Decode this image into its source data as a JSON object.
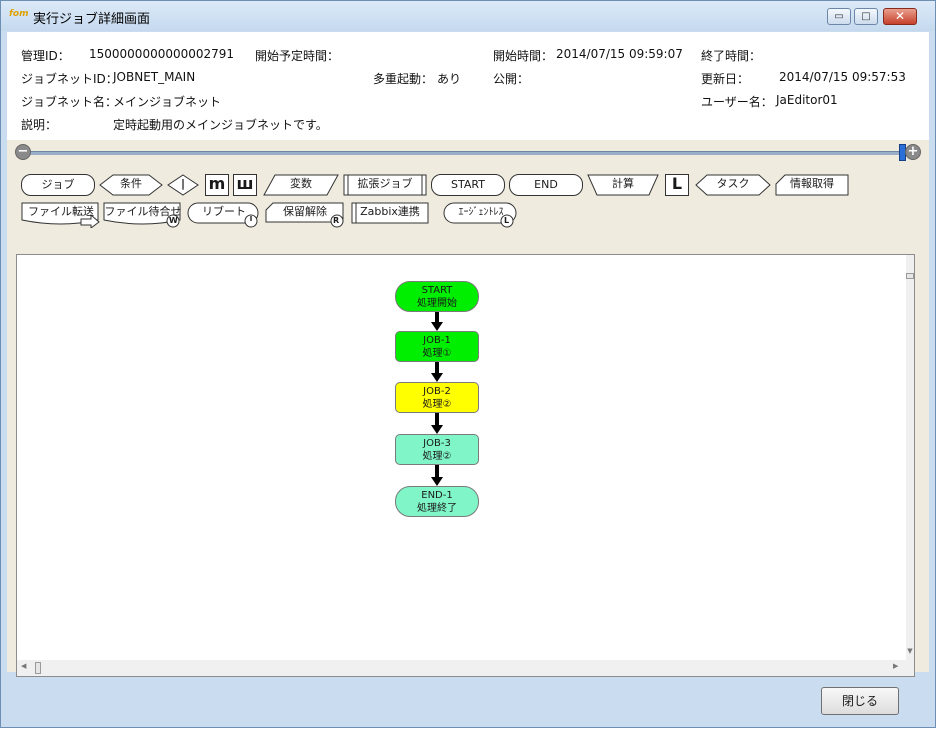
{
  "window": {
    "app_icon_text": "fom",
    "title": "実行ジョブ詳細画面",
    "minimize": "▭",
    "maximize": "□",
    "close": "✕"
  },
  "info": {
    "manage_id_label": "管理ID：",
    "manage_id_value": "1500000000000002791",
    "scheduled_start_label": "開始予定時間：",
    "start_time_label": "開始時間：",
    "start_time_value": "2014/07/15 09:59:07",
    "end_time_label": "終了時間：",
    "jobnet_id_label": "ジョブネットID：",
    "jobnet_id_value": "JOBNET_MAIN",
    "multi_start_label": "多重起動：",
    "multi_start_value": "あり",
    "public_label": "公開：",
    "updated_label": "更新日：",
    "updated_value": "2014/07/15 09:57:53",
    "jobnet_name_label": "ジョブネット名：",
    "jobnet_name_value": "メインジョブネット",
    "user_name_label": "ユーザー名：",
    "user_name_value": "JaEditor01",
    "description_label": "説明：",
    "description_value": "定時起動用のメインジョブネットです。"
  },
  "slider": {
    "minus": "−",
    "plus": "+",
    "zoom_fraction": 0.99
  },
  "palette": {
    "job": "ジョブ",
    "condition": "条件",
    "parallel_start": "|",
    "parallel_end_m": "m",
    "parallel_end_w": "ш",
    "variable": "変数",
    "ext_job": "拡張ジョブ",
    "start": "START",
    "end": "END",
    "calc": "計算",
    "loop": "L",
    "task": "タスク",
    "info_get": "情報取得",
    "file_transfer": "ファイル転送",
    "file_wait": "ファイル待合せ",
    "reboot": "リブート",
    "hold_release": "保留解除",
    "zabbix": "Zabbix連携",
    "agentless": "ｴｰｼﾞｪﾝﾄﾚｽ",
    "badge_w": "W",
    "badge_r": "R",
    "badge_l": "L"
  },
  "flow": {
    "nodes": [
      {
        "id": "START",
        "name": "処理開始"
      },
      {
        "id": "JOB-1",
        "name": "処理①"
      },
      {
        "id": "JOB-2",
        "name": "処理②"
      },
      {
        "id": "JOB-3",
        "name": "処理②"
      },
      {
        "id": "END-1",
        "name": "処理終了"
      }
    ],
    "colors": {
      "green": "#00ee00",
      "yellow": "#ffff00",
      "aqua": "#7ff5c8"
    }
  },
  "close_button": "閉じる"
}
